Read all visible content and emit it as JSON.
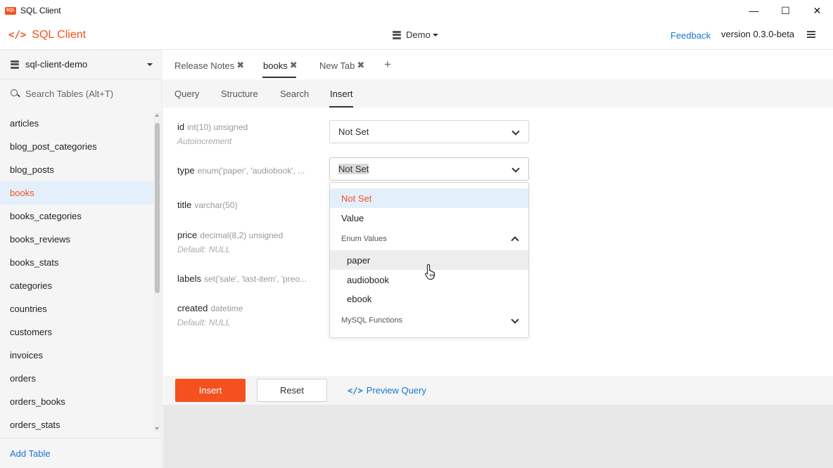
{
  "window": {
    "title": "SQL Client",
    "app_icon_text": "SQL",
    "controls": {
      "minimize": "—",
      "maximize": "☐",
      "close": "✕"
    }
  },
  "header": {
    "brand_icon": "</>",
    "brand": "SQL Client",
    "connection": "Demo",
    "feedback": "Feedback",
    "version": "version 0.3.0-beta"
  },
  "sidebar": {
    "database": "sql-client-demo",
    "search_placeholder": "Search Tables (Alt+T)",
    "tables": [
      "articles",
      "blog_post_categories",
      "blog_posts",
      "books",
      "books_categories",
      "books_reviews",
      "books_stats",
      "categories",
      "countries",
      "customers",
      "invoices",
      "orders",
      "orders_books",
      "orders_stats"
    ],
    "active_table": "books",
    "add_table": "Add Table"
  },
  "tabs": [
    {
      "label": "Release Notes",
      "close": "✖"
    },
    {
      "label": "books",
      "close": "✖"
    },
    {
      "label": "New Tab",
      "close": "✖"
    }
  ],
  "add_tab": "+",
  "subtabs": [
    "Query",
    "Structure",
    "Search",
    "Insert"
  ],
  "fields": [
    {
      "name": "id",
      "type": "int(10) unsigned",
      "note": "Autoincrement"
    },
    {
      "name": "type",
      "type": "enum('paper', 'audiobook', ...",
      "note": ""
    },
    {
      "name": "title",
      "type": "varchar(50)",
      "note": ""
    },
    {
      "name": "price",
      "type": "decimal(8,2) unsigned",
      "note": "Default: NULL"
    },
    {
      "name": "labels",
      "type": "set('sale', 'last-item', 'preo...",
      "note": ""
    },
    {
      "name": "created",
      "type": "datetime",
      "note": "Default: NULL"
    }
  ],
  "id_value": "Not Set",
  "type_value": "Not Set",
  "menu": {
    "not_set": "Not Set",
    "value": "Value",
    "enum_group": "Enum Values",
    "enum_values": [
      "paper",
      "audiobook",
      "ebook"
    ],
    "functions_group": "MySQL Functions"
  },
  "actions": {
    "insert": "Insert",
    "reset": "Reset",
    "preview_icon": "</>",
    "preview": "Preview Query"
  },
  "colors": {
    "accent": "#f4511e",
    "link": "#1976d2",
    "selected_bg": "#e3f0fb"
  }
}
